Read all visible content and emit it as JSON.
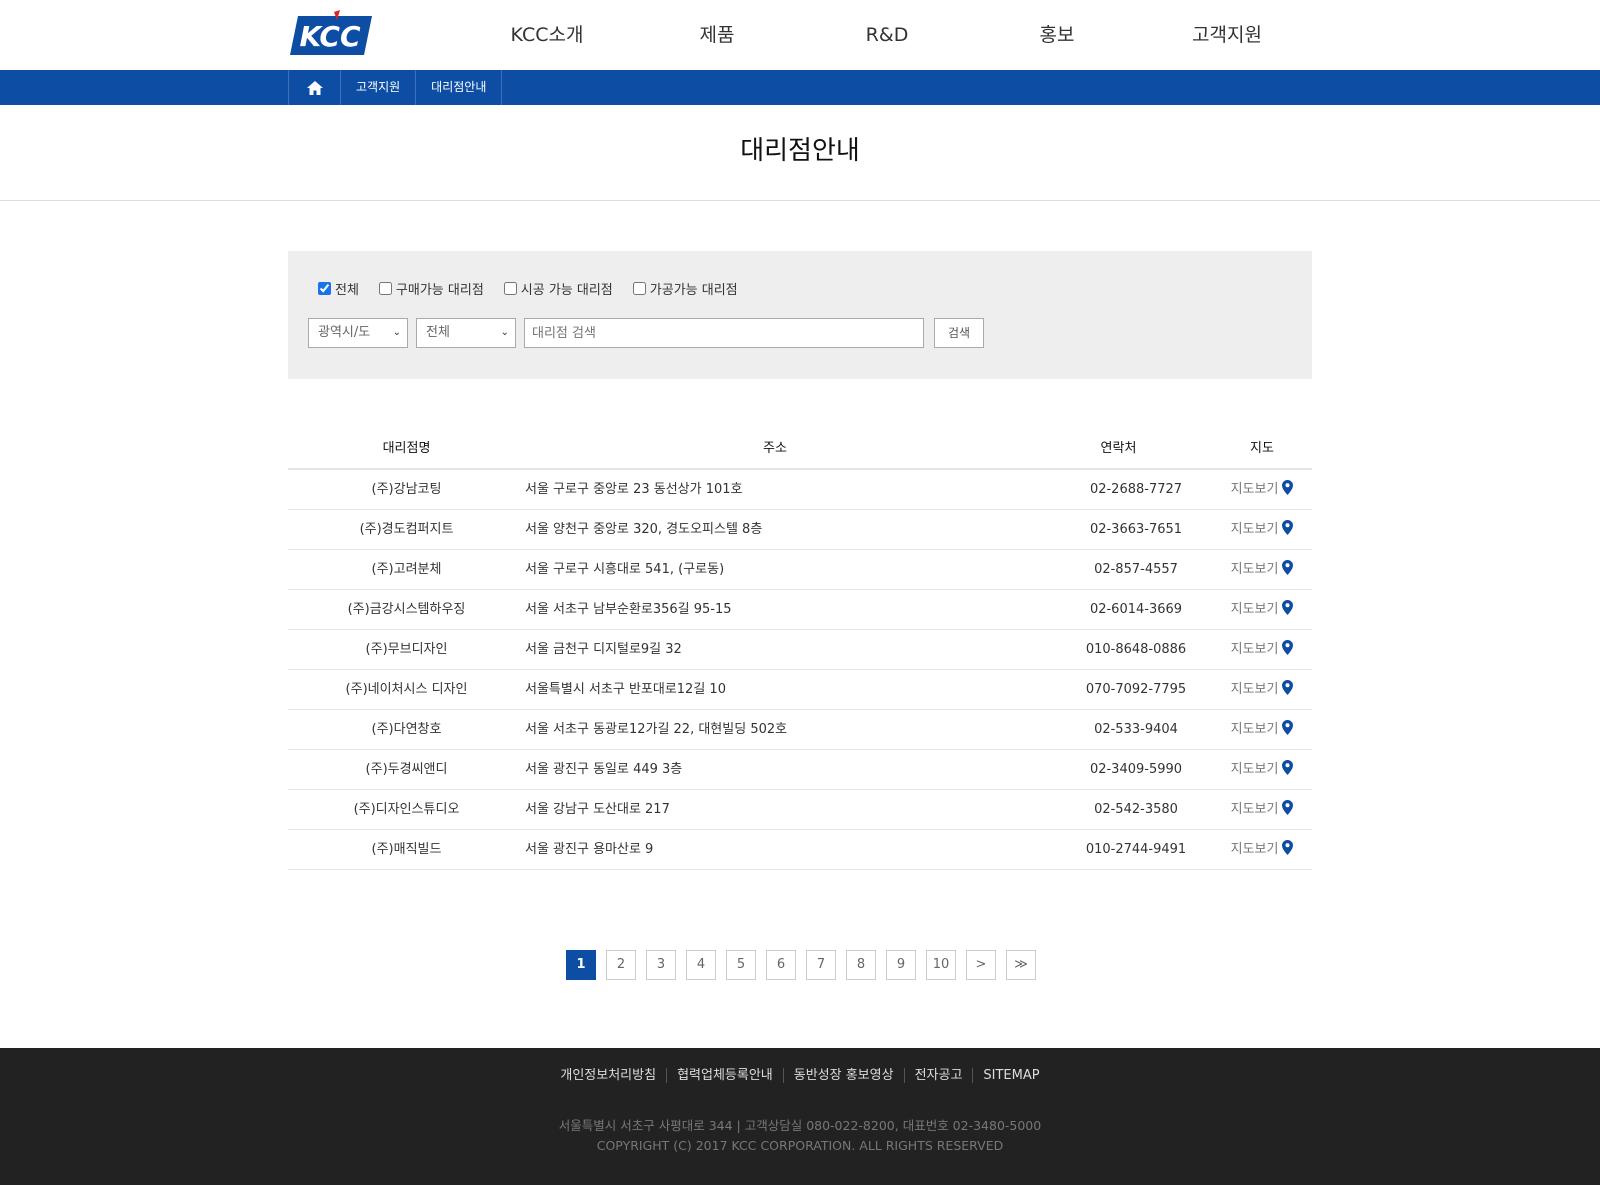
{
  "brand": {
    "name": "KCC",
    "color": "#0e4da4"
  },
  "nav": {
    "items": [
      {
        "label": "KCC소개"
      },
      {
        "label": "제품"
      },
      {
        "label": "R&D"
      },
      {
        "label": "홍보"
      },
      {
        "label": "고객지원"
      }
    ]
  },
  "breadcrumb": {
    "home_icon": "home-icon",
    "items": [
      {
        "label": "고객지원"
      },
      {
        "label": "대리점안내"
      }
    ]
  },
  "page": {
    "title": "대리점안내"
  },
  "search": {
    "checkboxes": [
      {
        "label": "전체",
        "checked": true
      },
      {
        "label": "구매가능 대리점",
        "checked": false
      },
      {
        "label": "시공 가능 대리점",
        "checked": false
      },
      {
        "label": "가공가능 대리점",
        "checked": false
      }
    ],
    "region_select": "광역시/도",
    "district_select": "전체",
    "placeholder": "대리점 검색",
    "button_label": "검색"
  },
  "table": {
    "headers": {
      "name": "대리점명",
      "address": "주소",
      "phone": "연락처",
      "map": "지도"
    },
    "map_label": "지도보기",
    "rows": [
      {
        "name": "(주)강남코팅",
        "address": "서울 구로구 중앙로 23 동선상가 101호",
        "phone": "02-2688-7727"
      },
      {
        "name": "(주)경도컴퍼지트",
        "address": "서울 양천구 중앙로 320, 경도오피스텔 8층",
        "phone": "02-3663-7651"
      },
      {
        "name": "(주)고려분체",
        "address": "서울 구로구 시흥대로 541, (구로동)",
        "phone": "02-857-4557"
      },
      {
        "name": "(주)금강시스템하우징",
        "address": "서울 서초구 남부순환로356길 95-15",
        "phone": "02-6014-3669"
      },
      {
        "name": "(주)무브디자인",
        "address": "서울 금천구 디지털로9길 32",
        "phone": "010-8648-0886"
      },
      {
        "name": "(주)네이처시스 디자인",
        "address": "서울특별시 서초구 반포대로12길 10",
        "phone": "070-7092-7795"
      },
      {
        "name": "(주)다연창호",
        "address": "서울 서초구 동광로12가길 22, 대현빌딩 502호",
        "phone": "02-533-9404"
      },
      {
        "name": "(주)두경씨앤디",
        "address": "서울 광진구 동일로 449 3층",
        "phone": "02-3409-5990"
      },
      {
        "name": "(주)디자인스튜디오",
        "address": "서울 강남구 도산대로 217",
        "phone": "02-542-3580"
      },
      {
        "name": "(주)매직빌드",
        "address": "서울 광진구 용마산로 9",
        "phone": "010-2744-9491"
      }
    ]
  },
  "pagination": {
    "pages": [
      "1",
      "2",
      "3",
      "4",
      "5",
      "6",
      "7",
      "8",
      "9",
      "10"
    ],
    "current": "1",
    "next": ">",
    "last": "≫"
  },
  "footer": {
    "links": [
      {
        "label": "개인정보처리방침"
      },
      {
        "label": "협력업체등록안내"
      },
      {
        "label": "동반성장 홍보영상"
      },
      {
        "label": "전자공고"
      },
      {
        "label": "SITEMAP"
      }
    ],
    "address": "서울특별시 서초구 사평대로 344 | 고객상담실 080-022-8200, 대표번호 02-3480-5000",
    "copyright": "COPYRIGHT (C) 2017 KCC CORPORATION. ALL RIGHTS RESERVED"
  }
}
